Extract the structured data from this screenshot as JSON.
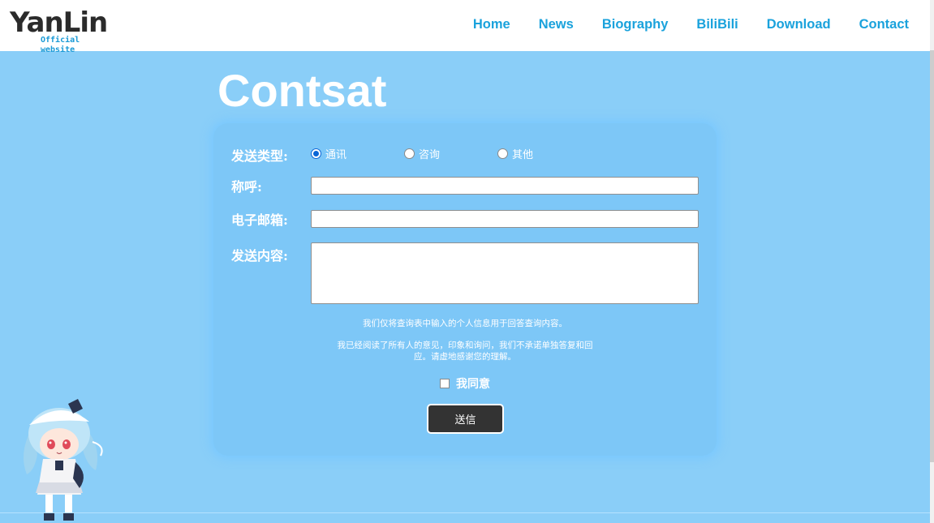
{
  "logo": {
    "main": "YanLin",
    "sub": "Official website"
  },
  "nav": {
    "items": [
      {
        "label": "Home"
      },
      {
        "label": "News"
      },
      {
        "label": "Biography"
      },
      {
        "label": "BiliBili"
      },
      {
        "label": "Download"
      },
      {
        "label": "Contact"
      }
    ]
  },
  "page": {
    "title": "Contsat"
  },
  "form": {
    "type_label": "发送类型:",
    "type_options": [
      {
        "label": "通讯",
        "checked": true
      },
      {
        "label": "咨询",
        "checked": false
      },
      {
        "label": "其他",
        "checked": false
      }
    ],
    "name_label": "称呼:",
    "name_value": "",
    "email_label": "电子邮箱:",
    "email_value": "",
    "content_label": "发送内容:",
    "content_value": "",
    "note_1": "我们仅将查询表中输入的个人信息用于回答查询内容。",
    "note_2": "我已经阅读了所有人的意见，印象和询问，我们不承诺单独答复和回应。请虚地感谢您的理解。",
    "agree_label": "我同意",
    "agree_checked": false,
    "submit_label": "送信"
  },
  "colors": {
    "background": "#8acef8",
    "card": "#7dc7f7",
    "nav_text": "#1aa2dc",
    "button": "#333333",
    "radio_accent": "#0a66d6"
  }
}
